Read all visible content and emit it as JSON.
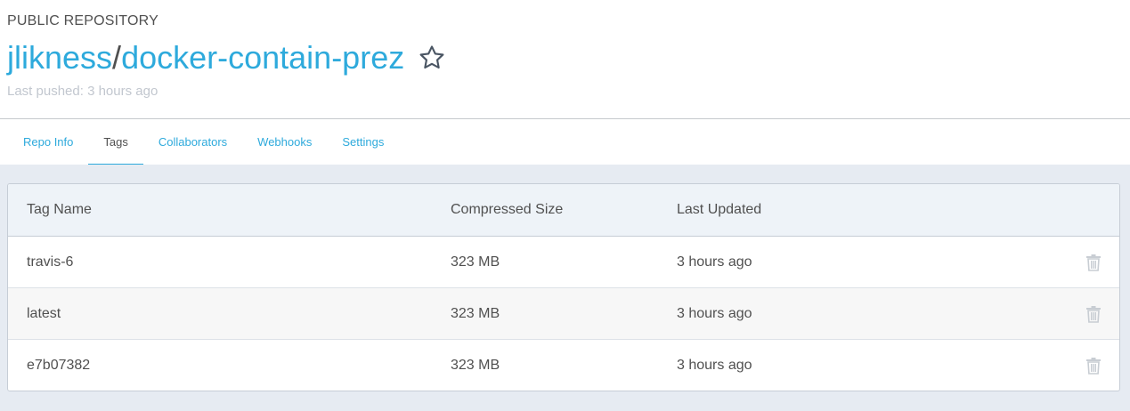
{
  "repo": {
    "visibility": "PUBLIC REPOSITORY",
    "owner": "jlikness",
    "separator": "/",
    "name": "docker-contain-prez",
    "last_pushed": "Last pushed: 3 hours ago",
    "star_icon": "star-outline-icon"
  },
  "tabs": [
    {
      "label": "Repo Info",
      "active": false
    },
    {
      "label": "Tags",
      "active": true
    },
    {
      "label": "Collaborators",
      "active": false
    },
    {
      "label": "Webhooks",
      "active": false
    },
    {
      "label": "Settings",
      "active": false
    }
  ],
  "table": {
    "columns": [
      "Tag Name",
      "Compressed Size",
      "Last Updated"
    ],
    "rows": [
      {
        "tag": "travis-6",
        "size": "323 MB",
        "updated": "3 hours ago"
      },
      {
        "tag": "latest",
        "size": "323 MB",
        "updated": "3 hours ago"
      },
      {
        "tag": "e7b07382",
        "size": "323 MB",
        "updated": "3 hours ago"
      }
    ],
    "delete_icon": "trash-icon"
  },
  "colors": {
    "accent": "#2eaadc",
    "text": "#505050",
    "muted": "#c2c7cf",
    "content_bg": "#e6ebf2",
    "header_row_bg": "#eef3f8"
  }
}
